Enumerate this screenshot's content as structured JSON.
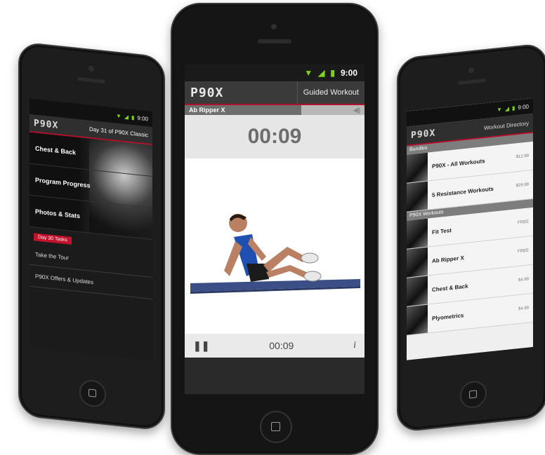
{
  "center": {
    "status": {
      "time": "9:00",
      "icons": [
        "wifi-icon",
        "signal-icon",
        "battery-icon"
      ]
    },
    "logo": "P90X",
    "screen_title": "Guided Workout",
    "workout_name": "Ab Ripper X",
    "progress": 0.65,
    "timer_large": "00:09",
    "timer_small": "00:09",
    "info_label": "i"
  },
  "left": {
    "status_time": "9:00",
    "logo": "P90X",
    "header_subtitle": "Day 31 of P90X Classic",
    "menu": [
      "Chest & Back",
      "Program Progress",
      "Photos & Stats"
    ],
    "tasks_tag": "Day 30 Tasks",
    "tasks": [
      "Take the Tour",
      "P90X Offers & Updates"
    ]
  },
  "right": {
    "status_time": "9:00",
    "logo": "P90X",
    "header_title": "Workout Directory",
    "sections": [
      {
        "title": "Bundles",
        "items": [
          {
            "name": "P90X - All Workouts",
            "price": "$12.99"
          },
          {
            "name": "5 Resistance Workouts",
            "price": "$29.99"
          }
        ]
      },
      {
        "title": "P90X Workouts",
        "items": [
          {
            "name": "Fit Test",
            "price": "FREE"
          },
          {
            "name": "Ab Ripper X",
            "price": "FREE"
          },
          {
            "name": "Chest & Back",
            "price": "$4.99"
          },
          {
            "name": "Plyometrics",
            "price": "$4.99"
          }
        ]
      }
    ]
  }
}
